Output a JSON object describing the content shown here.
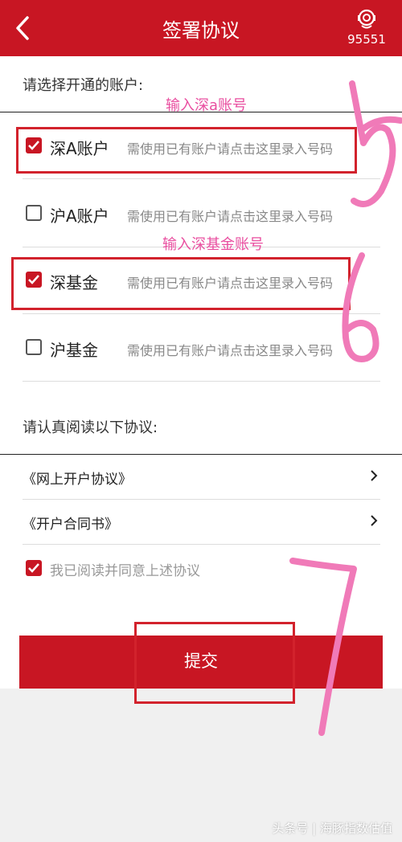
{
  "header": {
    "title": "签署协议",
    "phone": "95551"
  },
  "accounts_section": {
    "label": "请选择开通的账户:",
    "items": [
      {
        "name": "深A账户",
        "hint": "需使用已有账户请点击这里录入号码",
        "checked": true
      },
      {
        "name": "沪A账户",
        "hint": "需使用已有账户请点击这里录入号码",
        "checked": false
      },
      {
        "name": "深基金",
        "hint": "需使用已有账户请点击这里录入号码",
        "checked": true
      },
      {
        "name": "沪基金",
        "hint": "需使用已有账户请点击这里录入号码",
        "checked": false
      }
    ]
  },
  "agreements_section": {
    "label": "请认真阅读以下协议:",
    "items": [
      {
        "label": "《网上开户协议》"
      },
      {
        "label": "《开户合同书》"
      }
    ],
    "confirm": "我已阅读并同意上述协议"
  },
  "submit_label": "提交",
  "annotations": {
    "note1": "输入深a账号",
    "note2": "输入深基金账号",
    "digits": [
      "5",
      "6",
      "7"
    ]
  },
  "watermark": "头条号 | 海豚指数估值",
  "colors": {
    "brand": "#c81623",
    "annotation_pink": "#e94fa0",
    "annotation_red": "#d2222c"
  }
}
